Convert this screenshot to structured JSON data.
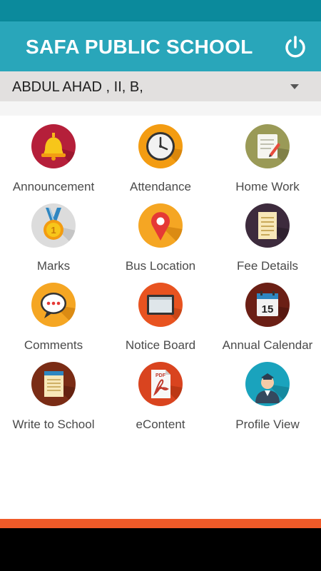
{
  "header": {
    "title": "SAFA PUBLIC SCHOOL",
    "power_icon": "power-icon"
  },
  "student_selector": {
    "value": "ABDUL AHAD , II, B,"
  },
  "menu": {
    "items": [
      {
        "label": "Announcement",
        "icon": "bell-icon",
        "color": "#b51f3a"
      },
      {
        "label": "Attendance",
        "icon": "clock-icon",
        "color": "#f39c12"
      },
      {
        "label": "Home Work",
        "icon": "notepad-icon",
        "color": "#9a9a57"
      },
      {
        "label": "Marks",
        "icon": "medal-icon",
        "color": "#dcdcdc"
      },
      {
        "label": "Bus Location",
        "icon": "map-pin-icon",
        "color": "#f5a623"
      },
      {
        "label": "Fee Details",
        "icon": "receipt-icon",
        "color": "#3d2b3d"
      },
      {
        "label": "Comments",
        "icon": "chat-bubble-icon",
        "color": "#f5a623"
      },
      {
        "label": "Notice Board",
        "icon": "board-icon",
        "color": "#e85320"
      },
      {
        "label": "Annual Calendar",
        "icon": "calendar-icon",
        "color": "#6b1f15"
      },
      {
        "label": "Write to School",
        "icon": "document-icon",
        "color": "#7a2c15"
      },
      {
        "label": "eContent",
        "icon": "pdf-icon",
        "color": "#d9441f"
      },
      {
        "label": "Profile View",
        "icon": "user-icon",
        "color": "#1aa3bd"
      }
    ]
  },
  "calendar_day": "15",
  "pdf_text": "PDF"
}
